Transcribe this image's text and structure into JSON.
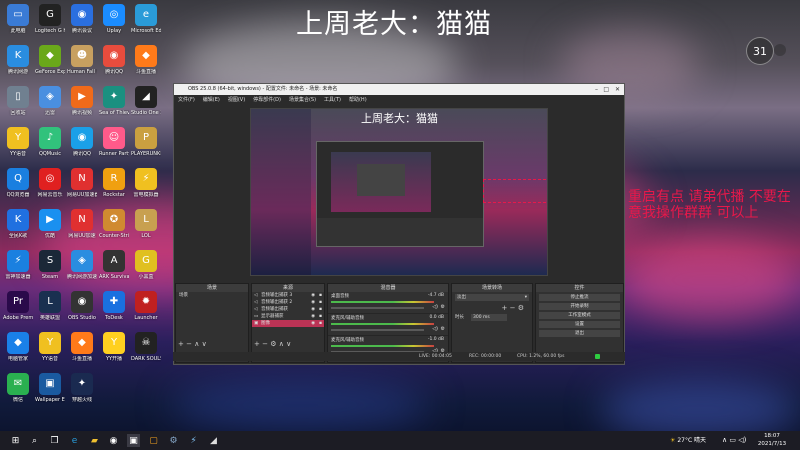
{
  "overlay": {
    "title": "上周老大：猫猫",
    "red_text": "重启有点  请弟代播  不要在意我操作群群  可以上"
  },
  "clock_bubble": "31",
  "desktop_icons": [
    {
      "label": "此电脑",
      "color": "#3a7bd5",
      "glyph": "▭"
    },
    {
      "label": "Logitech G HUB",
      "color": "#222",
      "glyph": "G"
    },
    {
      "label": "腾讯会议",
      "color": "#2a6fdf",
      "glyph": "◉"
    },
    {
      "label": "Uplay",
      "color": "#1a8cff",
      "glyph": "◎"
    },
    {
      "label": "Microsoft Edge",
      "color": "#2a9bd8",
      "glyph": "e"
    },
    {
      "label": "腾讯网游",
      "color": "#2a8de0",
      "glyph": "K"
    },
    {
      "label": "GeForce Experience",
      "color": "#6aa81a",
      "glyph": "◆"
    },
    {
      "label": "Human Fall Flat",
      "color": "#c8a060",
      "glyph": "☻"
    },
    {
      "label": "腾讯QQ",
      "color": "#e84c3d",
      "glyph": "◉"
    },
    {
      "label": "斗鱼直播",
      "color": "#ff7a1a",
      "glyph": "◆"
    },
    {
      "label": "回收站",
      "color": "#708090",
      "glyph": "▯"
    },
    {
      "label": "迅雷",
      "color": "#4a8fe0",
      "glyph": "◈"
    },
    {
      "label": "腾讯视频",
      "color": "#f06a1a",
      "glyph": "▶"
    },
    {
      "label": "Sea of Thieves",
      "color": "#1a9080",
      "glyph": "✦"
    },
    {
      "label": "Studio One 3",
      "color": "#222",
      "glyph": "◢"
    },
    {
      "label": "YY语音",
      "color": "#f0c020",
      "glyph": "Y"
    },
    {
      "label": "QQMusic",
      "color": "#31c27c",
      "glyph": "♪"
    },
    {
      "label": "腾讯QQ",
      "color": "#1aa0e8",
      "glyph": "◉"
    },
    {
      "label": "Runner Party",
      "color": "#ff5a8a",
      "glyph": "☺"
    },
    {
      "label": "PLAYERUNKNOWN'S",
      "color": "#caa040",
      "glyph": "P"
    },
    {
      "label": "QQ浏览器",
      "color": "#1a7fe0",
      "glyph": "Q"
    },
    {
      "label": "网易云音乐",
      "color": "#e02020",
      "glyph": "◎"
    },
    {
      "label": "网易UU加速器",
      "color": "#e03030",
      "glyph": "N"
    },
    {
      "label": "Rockstar",
      "color": "#f0a010",
      "glyph": "R"
    },
    {
      "label": "雷电模拟器",
      "color": "#f0c020",
      "glyph": "⚡"
    },
    {
      "label": "全民K歌",
      "color": "#2070e0",
      "glyph": "K"
    },
    {
      "label": "优酷",
      "color": "#1a90f0",
      "glyph": "▶"
    },
    {
      "label": "网易UU加速",
      "color": "#e03030",
      "glyph": "N"
    },
    {
      "label": "Counter-Strike",
      "color": "#d08a30",
      "glyph": "✪"
    },
    {
      "label": "LOL",
      "color": "#c8a050",
      "glyph": "L"
    },
    {
      "label": "雷神加速器",
      "color": "#1a80e0",
      "glyph": "⚡"
    },
    {
      "label": "Steam",
      "color": "#1b2838",
      "glyph": "S"
    },
    {
      "label": "腾讯网游加速",
      "color": "#2a8de0",
      "glyph": "◈"
    },
    {
      "label": "ARK Survival Evolved",
      "color": "#333",
      "glyph": "A"
    },
    {
      "label": "小黑盒",
      "color": "#e0c020",
      "glyph": "G"
    },
    {
      "label": "Adobe Premiere",
      "color": "#2a0a4a",
      "glyph": "Pr"
    },
    {
      "label": "英雄联盟",
      "color": "#1a3050",
      "glyph": "L"
    },
    {
      "label": "OBS Studio",
      "color": "#333",
      "glyph": "◉"
    },
    {
      "label": "ToDesk",
      "color": "#1a70e0",
      "glyph": "✚"
    },
    {
      "label": "Launcher",
      "color": "#c02020",
      "glyph": "✹"
    },
    {
      "label": "电脑管家",
      "color": "#1a80e8",
      "glyph": "◆"
    },
    {
      "label": "YY语音",
      "color": "#f0c020",
      "glyph": "Y"
    },
    {
      "label": "斗鱼直播",
      "color": "#ff7a1a",
      "glyph": "◆"
    },
    {
      "label": "YY开播",
      "color": "#ffd020",
      "glyph": "Y"
    },
    {
      "label": "DARK SOULS III",
      "color": "#222",
      "glyph": "☠"
    },
    {
      "label": "微信",
      "color": "#2ab050",
      "glyph": "✉"
    },
    {
      "label": "Wallpaper Engine",
      "color": "#1a5aa0",
      "glyph": "▣"
    },
    {
      "label": "穿越火线",
      "color": "#1a2a50",
      "glyph": "✦"
    }
  ],
  "obs": {
    "title": "OBS 25.0.8 (64-bit, windows) - 配置文件: 未命名 - 场景: 未命名",
    "menu": [
      "文件(F)",
      "编辑(E)",
      "视图(V)",
      "停靠部件(D)",
      "场景集合(S)",
      "工具(T)",
      "帮助(H)"
    ],
    "preview_title": "上周老大：猫猫",
    "docks": {
      "scenes_header": "场景",
      "scene_name": "场景",
      "sources_header": "来源",
      "sources": [
        "音频输出捕获 3",
        "音频输出捕获 2",
        "音频输出捕获",
        "显示器捕获",
        "图像"
      ],
      "mixer_header": "混音器",
      "mixer": [
        {
          "name": "桌面音频",
          "db": "-4.7 dB"
        },
        {
          "name": "麦克风/辅助音频",
          "db": "0.0 dB"
        },
        {
          "name": "麦克风/辅助音频",
          "db": "-1.0 dB"
        }
      ],
      "transitions_header": "场景转场",
      "transition_type": "淡出",
      "duration_label": "时长",
      "duration_value": "300 ms",
      "controls_header": "控件",
      "controls": [
        "停止推流",
        "开始录制",
        "工作室模式",
        "设置",
        "退出"
      ]
    },
    "status": {
      "live": "LIVE: 00:04:05",
      "rec": "REC: 00:00:00",
      "cpu": "CPU: 1.2%, 60.00 fps"
    }
  },
  "taskbar": {
    "items": [
      "start",
      "search",
      "task-view",
      "edge",
      "explorer",
      "obs",
      "store",
      "steam",
      "qq",
      "studio"
    ],
    "weather": "27°C 晴天",
    "time": "18:07",
    "date": "2021/7/13"
  }
}
